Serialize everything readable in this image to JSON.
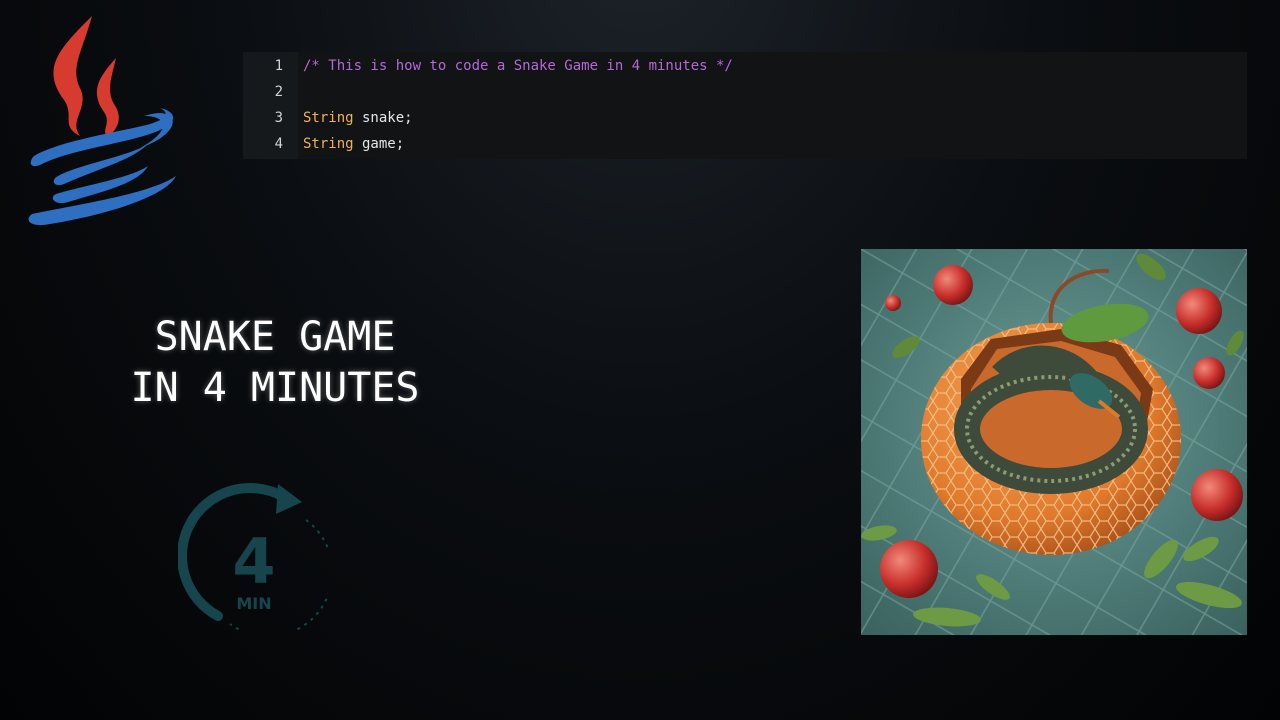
{
  "logo": {
    "icon": "java-coffee-cup-icon"
  },
  "code_editor": {
    "lines": [
      {
        "number": "1",
        "comment": "/* This is how to code a Snake Game in 4 minutes */"
      },
      {
        "number": "2"
      },
      {
        "number": "3",
        "keyword": "String",
        "text": " snake;"
      },
      {
        "number": "4",
        "keyword": "String",
        "text": " game;"
      }
    ],
    "colors": {
      "comment": "#b26ad6",
      "keyword": "#f0b354",
      "text": "#e6e6e6",
      "background": "#111315"
    }
  },
  "title": {
    "text": "SNAKE GAME\nIN 4 MINUTES"
  },
  "timer": {
    "number": "4",
    "unit": "MIN",
    "icon": "timer-arrow-icon",
    "color": "#16454d"
  },
  "illustration": {
    "icon": "snake-in-apple-illustration"
  }
}
